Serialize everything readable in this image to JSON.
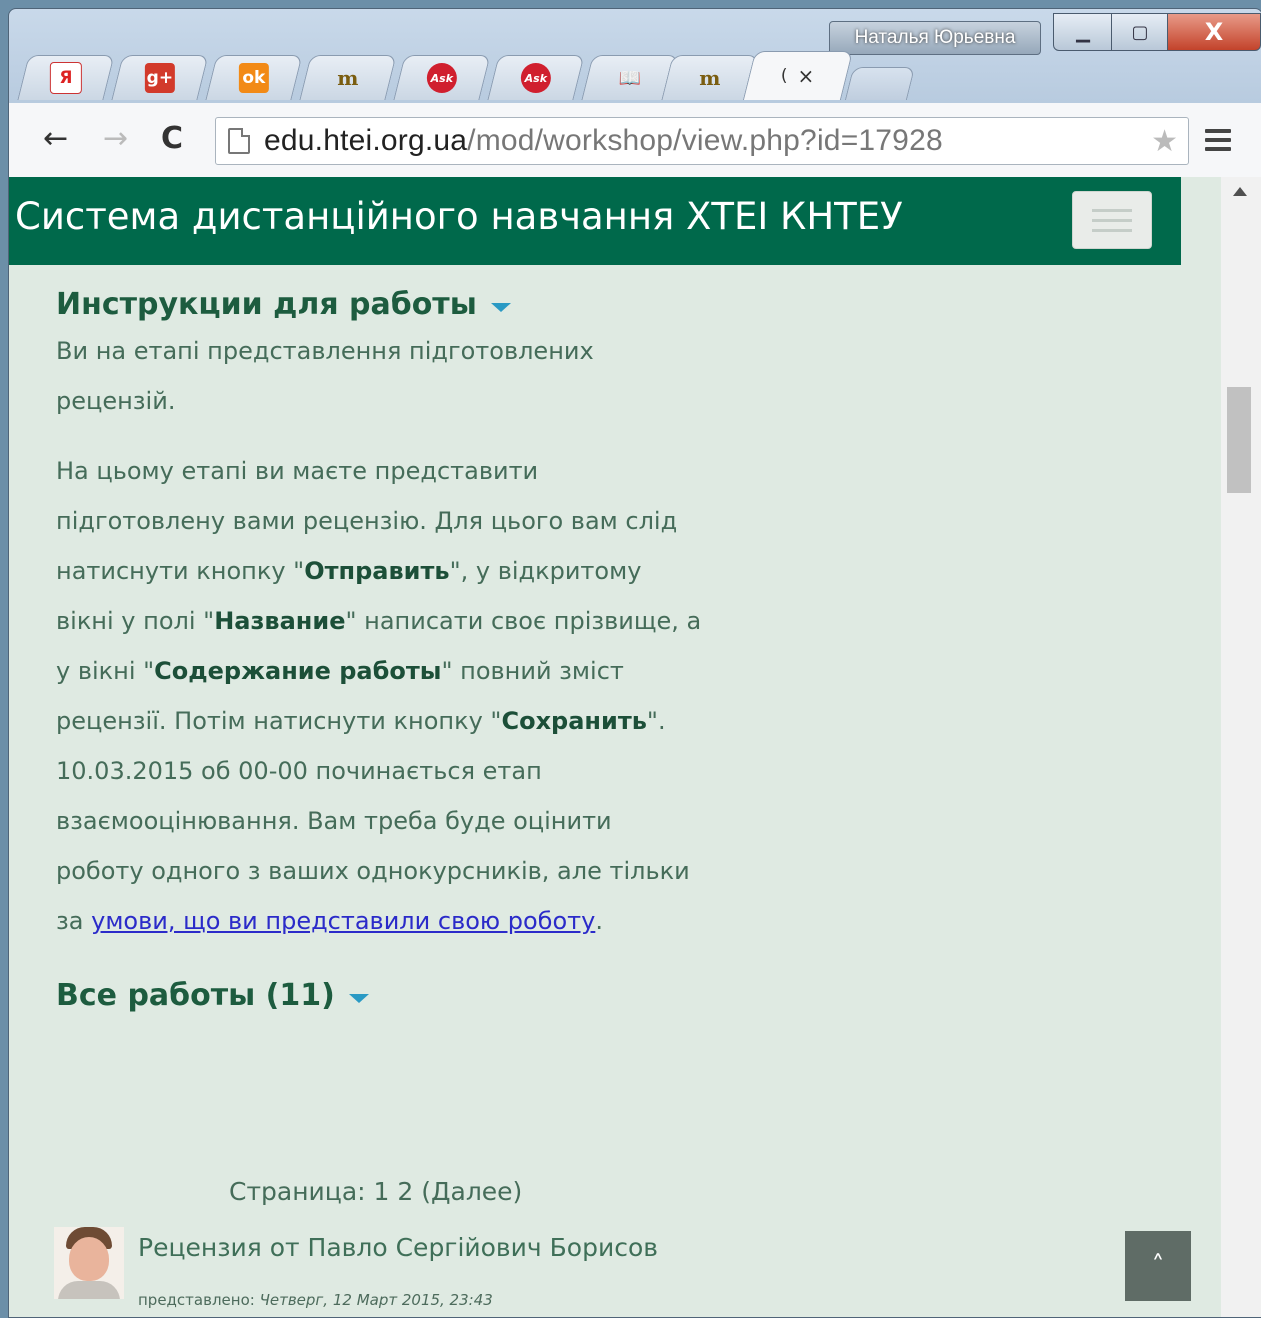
{
  "window": {
    "user": "Наталья Юрьевна",
    "controls": {
      "minimize": "▁",
      "maximize": "▢",
      "close": "X"
    }
  },
  "tabs": [
    {
      "icon": "yandex-icon",
      "glyph": "Я"
    },
    {
      "icon": "google-plus-icon",
      "glyph": "g+"
    },
    {
      "icon": "odnoklassniki-icon",
      "glyph": "ok"
    },
    {
      "icon": "fm-icon",
      "glyph": "m"
    },
    {
      "icon": "ask-icon",
      "glyph": "Ask"
    },
    {
      "icon": "ask-icon",
      "glyph": "Ask"
    },
    {
      "icon": "book-icon",
      "glyph": "📖"
    },
    {
      "icon": "fm-icon",
      "glyph": "m"
    },
    {
      "title": "(",
      "close": "×",
      "active": true
    }
  ],
  "toolbar": {
    "back": "←",
    "forward": "→",
    "reload": "C",
    "url_host": "edu.htei.org.ua",
    "url_path": "/mod/workshop/view.php?id=17928",
    "star": "★"
  },
  "page": {
    "brand": "Система дистанційного навчання ХТЕІ КНТЕУ",
    "instructions": {
      "heading": "Инструкции для работы",
      "p1": "Ви на етапі представлення підготовлених рецензій.",
      "p2_parts": [
        "На цьому етапі ви маєте представити підготовлену вами рецензію. Для цього вам слід натиснути кнопку \"",
        "Отправить",
        "\", у відкритому вікні у полі \"",
        "Название",
        "\" написати своє прізвище, а у вікні \"",
        "Содержание работы",
        "\" повний зміст рецензії. Потім натиснути кнопку \"",
        "Сохранить",
        "\".",
        "10.03.2015 об 00-00  починається етап взаємооцінювання. Вам треба буде оцінити роботу одного з ваших однокурсників, але тільки за ",
        "умови, що ви представили свою роботу",
        "."
      ]
    },
    "submissions": {
      "heading": "Все работы (11)",
      "pager": "Страница:  1  2  (Далее)",
      "entry": {
        "title": "Рецензия  от Павло Сергійович Борисов",
        "meta_label": "представлено: ",
        "meta_date": "Четверг, 12 Март 2015, 23:43"
      }
    },
    "back_to_top": "˄"
  }
}
